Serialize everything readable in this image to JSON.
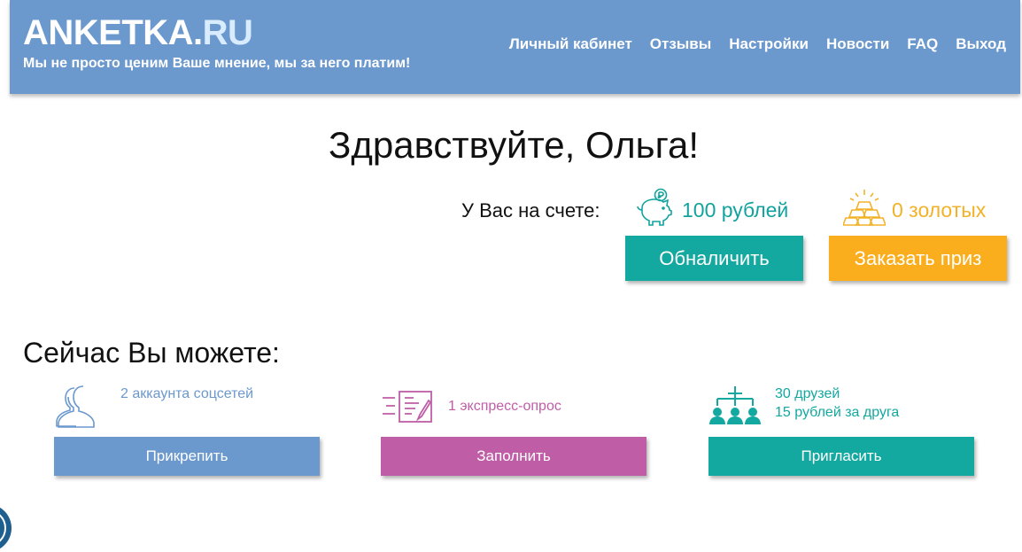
{
  "header": {
    "logo_main": "ANKETKA.",
    "logo_ru": "RU",
    "tagline": "Мы не просто ценим Ваше мнение, мы за него платим!",
    "nav": [
      "Личный кабинет",
      "Отзывы",
      "Настройки",
      "Новости",
      "FAQ",
      "Выход"
    ]
  },
  "greeting": "Здравствуйте, Ольга!",
  "balance": {
    "label": "У Вас на счете:",
    "rubles": "100 рублей",
    "gold": "0 золотых",
    "cash_button": "Обналичить",
    "prize_button": "Заказать приз"
  },
  "actions": {
    "title": "Сейчас Вы можете:",
    "items": [
      {
        "text": "2 аккаунта соцсетей",
        "button": "Прикрепить"
      },
      {
        "text": "1 экспресс-опрос",
        "button": "Заполнить"
      },
      {
        "line1": "30 друзей",
        "line2": "15 рублей за друга",
        "button": "Пригласить"
      }
    ]
  },
  "colors": {
    "header_bg": "#6b98cd",
    "teal": "#13a8a0",
    "orange": "#fbae1d",
    "purple": "#bf5ea6",
    "blue": "#6b98cd"
  },
  "icons": {
    "piggy": "piggy-bank-icon",
    "gold": "gold-bars-icon",
    "users": "users-icon",
    "survey": "survey-form-icon",
    "referral": "referral-tree-icon"
  }
}
